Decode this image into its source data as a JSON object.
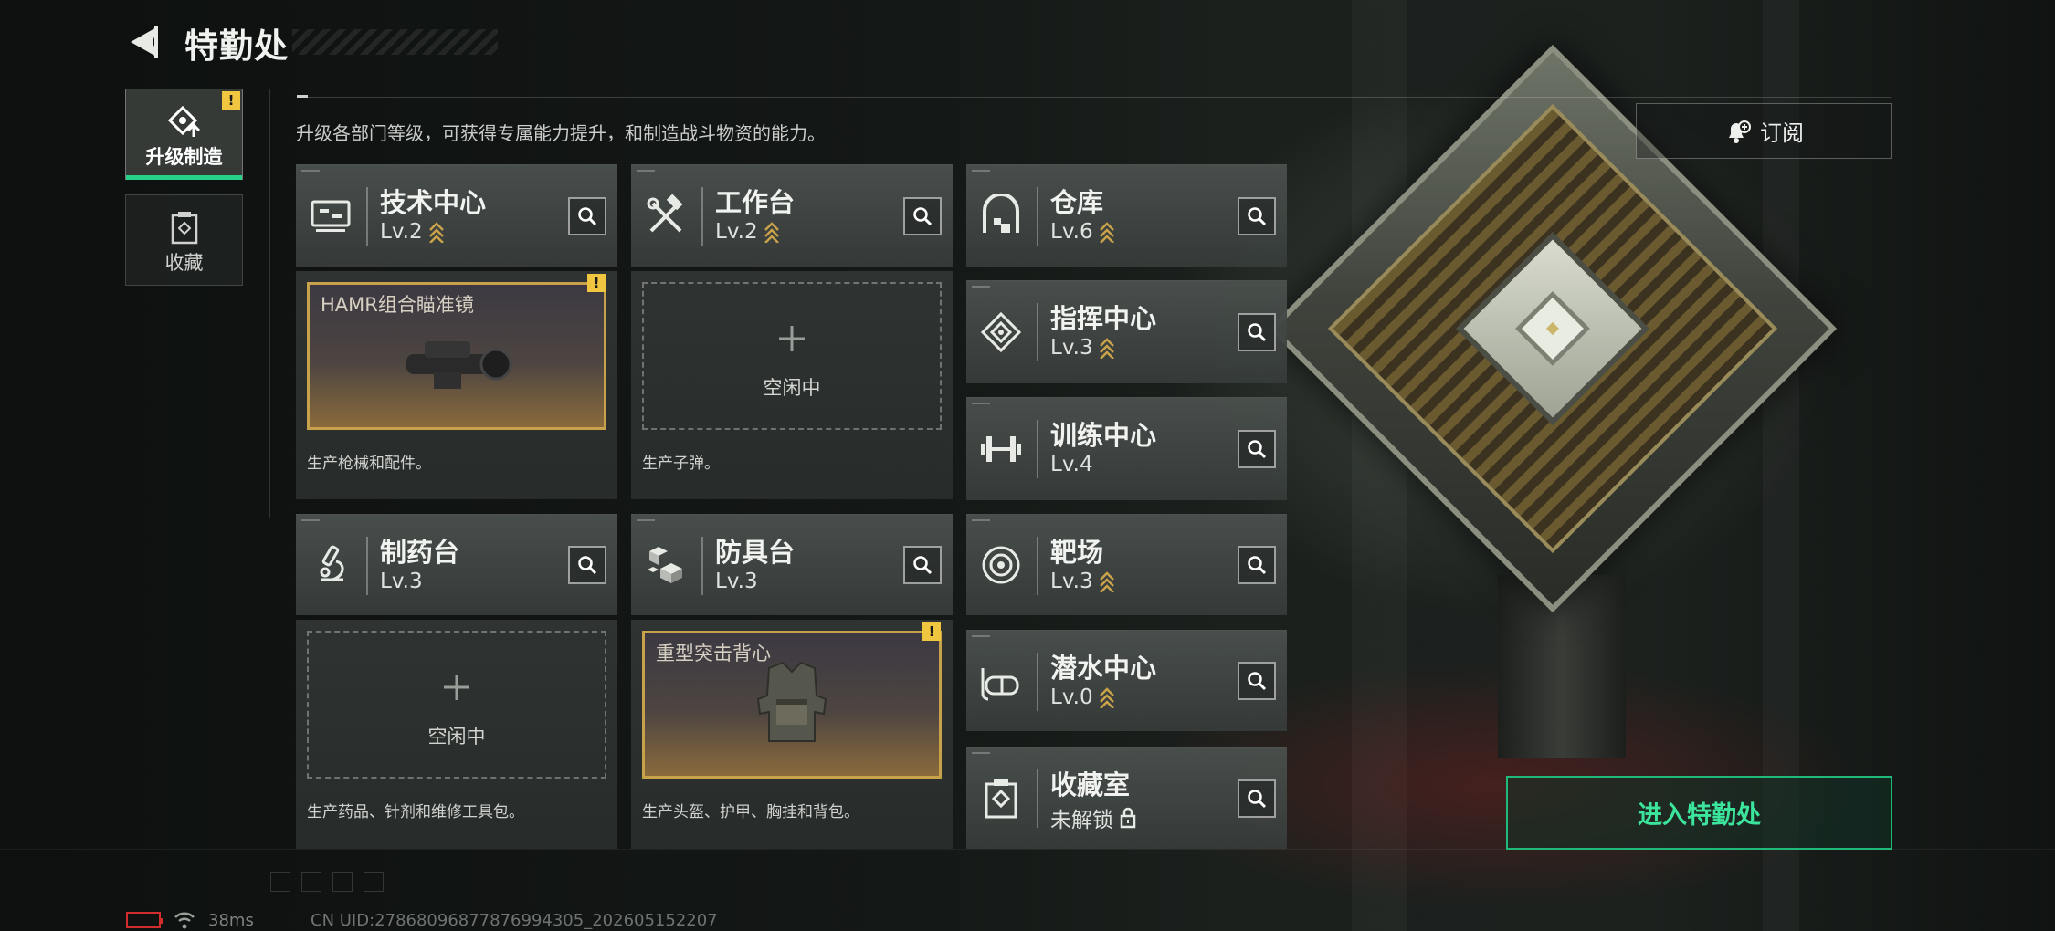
{
  "header": {
    "title": "特勤处",
    "description": "升级各部门等级，可获得专属能力提升，和制造战斗物资的能力。"
  },
  "side_tabs": [
    {
      "label": "升级制造",
      "active": true,
      "badge": "!"
    },
    {
      "label": "收藏",
      "active": false
    }
  ],
  "facilities_left": [
    {
      "name": "技术中心",
      "level": "Lv.2",
      "upgradable": true,
      "icon": "monitor-icon",
      "slot": {
        "state": "filled",
        "item": "HAMR组合瞄准镜",
        "badge": "!"
      },
      "desc": "生产枪械和配件。"
    },
    {
      "name": "工作台",
      "level": "Lv.2",
      "upgradable": true,
      "icon": "hammer-wrench-icon",
      "slot": {
        "state": "empty",
        "idle_label": "空闲中"
      },
      "desc": "生产子弹。"
    },
    {
      "name": "制药台",
      "level": "Lv.3",
      "upgradable": false,
      "icon": "microscope-icon",
      "slot": {
        "state": "empty",
        "idle_label": "空闲中"
      },
      "desc": "生产药品、针剂和维修工具包。"
    },
    {
      "name": "防具台",
      "level": "Lv.3",
      "upgradable": false,
      "icon": "boxes-icon",
      "slot": {
        "state": "filled",
        "item": "重型突击背心",
        "badge": "!"
      },
      "desc": "生产头盔、护甲、胸挂和背包。"
    }
  ],
  "facilities_right": [
    {
      "name": "仓库",
      "level": "Lv.6",
      "upgradable": true,
      "icon": "warehouse-icon"
    },
    {
      "name": "指挥中心",
      "level": "Lv.3",
      "upgradable": true,
      "icon": "command-diamond-icon"
    },
    {
      "name": "训练中心",
      "level": "Lv.4",
      "upgradable": false,
      "icon": "dumbbell-icon"
    },
    {
      "name": "靶场",
      "level": "Lv.3",
      "upgradable": true,
      "icon": "target-icon"
    },
    {
      "name": "潜水中心",
      "level": "Lv.0",
      "upgradable": true,
      "icon": "diving-mask-icon"
    },
    {
      "name": "收藏室",
      "level": "未解锁",
      "locked": true,
      "upgradable": false,
      "icon": "collection-icon"
    }
  ],
  "buttons": {
    "subscribe": "订阅",
    "enter": "进入特勤处"
  },
  "status": {
    "ping": "38ms",
    "uid": "CN UID:27868096877876994305_202605152207"
  },
  "colors": {
    "accent_green": "#27d18a",
    "warning_yellow": "#f0c540",
    "upgrade_gold": "#c9a24a"
  }
}
